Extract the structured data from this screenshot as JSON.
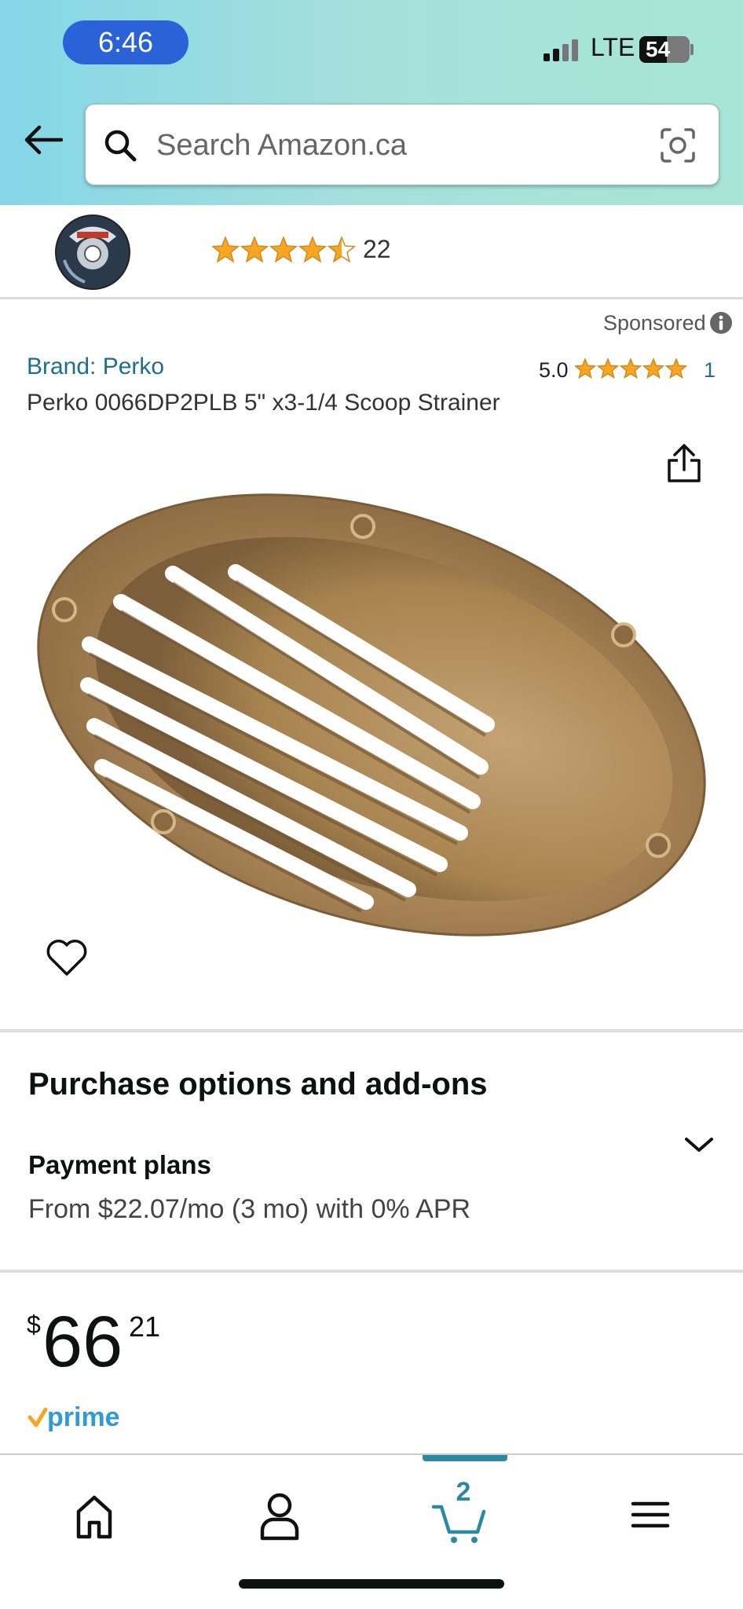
{
  "status_bar": {
    "time": "6:46",
    "network": "LTE",
    "battery": "54",
    "battery_level": 0.54
  },
  "header": {
    "back_icon": "arrow-left-icon",
    "search_placeholder": "Search Amazon.ca",
    "search_icon": "search-icon",
    "camera_icon": "camera-lens-icon",
    "gradient_colors": [
      "#85d6e8",
      "#a7e6d6"
    ]
  },
  "sponsored_strip": {
    "rating_stars": 4.5,
    "rating_count": "22"
  },
  "product": {
    "sponsored_label": "Sponsored",
    "brand": "Brand: Perko",
    "rating_value": "5.0",
    "rating_stars": 5,
    "rating_count": "1",
    "title": "Perko 0066DP2PLB 5\" x3-1/4 Scoop Strainer"
  },
  "purchase": {
    "heading": "Purchase options and add-ons",
    "payment_label": "Payment plans",
    "payment_detail": "From $22.07/mo (3 mo) with 0% APR"
  },
  "price": {
    "symbol": "$",
    "whole": "66",
    "fraction": "21"
  },
  "prime_badge": "prime",
  "bottom_nav": {
    "items": [
      "home-icon",
      "account-icon",
      "cart-icon",
      "menu-icon"
    ],
    "cart_count": "2",
    "accent": "#2b8aa0"
  },
  "colors": {
    "link": "#1f6e8a",
    "star": "#f5a623"
  }
}
